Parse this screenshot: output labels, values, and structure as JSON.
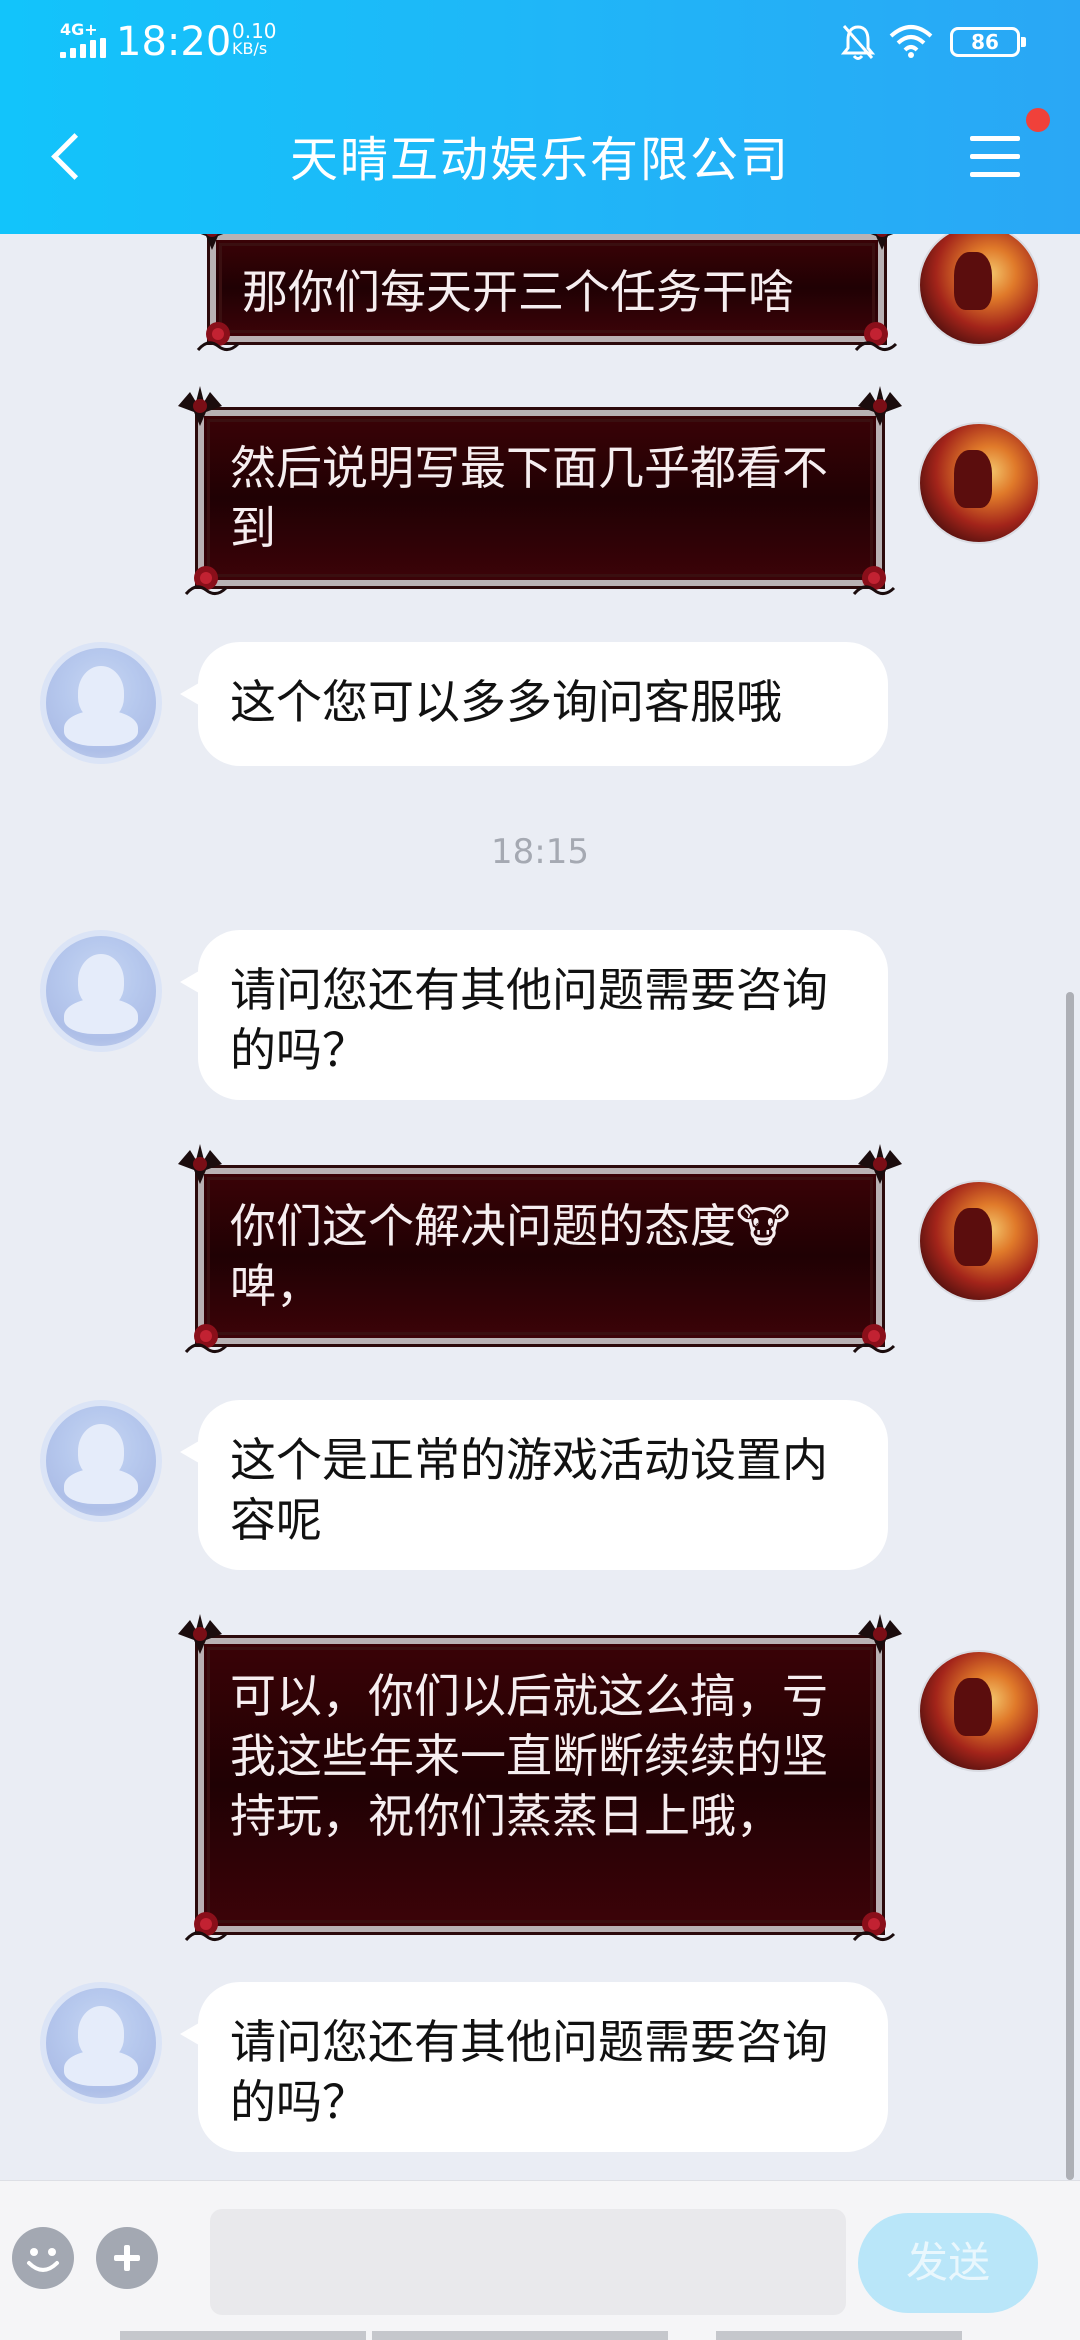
{
  "status_bar": {
    "network": "4G+",
    "time": "18:20",
    "net_speed_value": "0.10",
    "net_speed_unit": "KB/s",
    "battery": "86",
    "icons": [
      "signal-icon",
      "bell-muted-icon",
      "wifi-icon",
      "battery-icon"
    ]
  },
  "nav": {
    "back_icon": "chevron-left-icon",
    "title": "天晴互动娱乐有限公司",
    "menu_icon": "hamburger-menu-icon",
    "has_notification_dot": true,
    "accent_color": "#1cbcf9"
  },
  "messages": [
    {
      "sender": "user",
      "text": "那你们每天开三个任务干啥"
    },
    {
      "sender": "user",
      "text": "然后说明写最下面几乎都看不到"
    },
    {
      "sender": "service",
      "text": "这个您可以多多询问客服哦"
    },
    {
      "type": "time",
      "text": "18:15"
    },
    {
      "sender": "service",
      "text": "请问您还有其他问题需要咨询的吗？"
    },
    {
      "sender": "user",
      "text": "你们这个解决问题的态度🐮啤，"
    },
    {
      "sender": "service",
      "text": "这个是正常的游戏活动设置内容呢"
    },
    {
      "sender": "user",
      "text": "可以，你们以后就这么搞，亏我这些年来一直断断续续的坚持玩，祝你们蒸蒸日上哦，"
    },
    {
      "sender": "service",
      "text": "请问您还有其他问题需要咨询的吗？"
    }
  ],
  "input": {
    "emoji_icon": "emoji-icon",
    "plus_icon": "plus-icon",
    "value": "",
    "send_label": "发送"
  }
}
